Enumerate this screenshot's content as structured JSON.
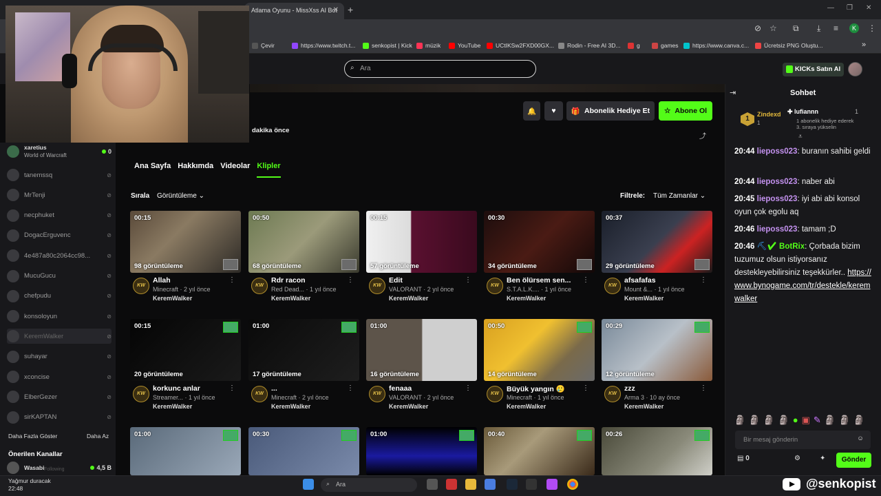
{
  "browser": {
    "tab_title": "Atlama Oyunu - MissXss AI Bot",
    "tab_close": "✕",
    "new_tab": "+",
    "bookmarks": [
      {
        "label": "Çevir",
        "color": "#555"
      },
      {
        "label": "https://www.twitch.t...",
        "color": "#9146ff"
      },
      {
        "label": "senkopist | Kick",
        "color": "#53fc18"
      },
      {
        "label": "müzik",
        "color": "#ff3355"
      },
      {
        "label": "YouTube",
        "color": "#ff0000"
      },
      {
        "label": "UCtIKSw2FXD00GX...",
        "color": "#ff0000"
      },
      {
        "label": "Rodin - Free AI 3D...",
        "color": "#888"
      },
      {
        "label": "g",
        "color": "#d33"
      },
      {
        "label": "games",
        "color": "#c44"
      },
      {
        "label": "https://www.canva.c...",
        "color": "#00c4cc"
      },
      {
        "label": "Ücretsiz PNG Oluştu...",
        "color": "#e44"
      }
    ],
    "more_bookmarks": "»",
    "profile_initial": "K"
  },
  "header": {
    "search_placeholder": "Ara",
    "kicks_button": "KICKs Satın Al"
  },
  "channel": {
    "actions": {
      "gift": "Abonelik Hediye Et",
      "subscribe": "Abone Ol"
    },
    "last_live": "dakika önce",
    "tabs": [
      "Ana Sayfa",
      "Hakkımda",
      "Videolar",
      "Klipler"
    ],
    "sort_label": "Sırala",
    "sort_value": "Görüntüleme",
    "filter_label": "Filtrele:",
    "filter_value": "Tüm Zamanlar"
  },
  "clips": [
    {
      "dur": "00:15",
      "views": "98 görüntüleme",
      "title": "Allah",
      "game": "Minecraft",
      "ago": "2 yıl önce",
      "author": "KeremWalker"
    },
    {
      "dur": "00:50",
      "views": "68 görüntüleme",
      "title": "Rdr racon",
      "game": "Red Dead...",
      "ago": "1 yıl önce",
      "author": "KeremWalker"
    },
    {
      "dur": "00:15",
      "views": "57 görüntüleme",
      "title": "Edit",
      "game": "VALORANT",
      "ago": "2 yıl önce",
      "author": "KeremWalker"
    },
    {
      "dur": "00:30",
      "views": "34 görüntüleme",
      "title": "Ben ölürsem sen...",
      "game": "S.T.A.L.K....",
      "ago": "1 yıl önce",
      "author": "KeremWalker"
    },
    {
      "dur": "00:37",
      "views": "29 görüntüleme",
      "title": "afsafafas",
      "game": "Mount &...",
      "ago": "1 yıl önce",
      "author": "KeremWalker"
    },
    {
      "dur": "00:15",
      "views": "20 görüntüleme",
      "title": "korkunc anlar",
      "game": "Streamer...",
      "ago": "1 yıl önce",
      "author": "KeremWalker"
    },
    {
      "dur": "01:00",
      "views": "17 görüntüleme",
      "title": "...",
      "game": "Minecraft",
      "ago": "2 yıl önce",
      "author": "KeremWalker"
    },
    {
      "dur": "01:00",
      "views": "16 görüntüleme",
      "title": "fenaaa",
      "game": "VALORANT",
      "ago": "2 yıl önce",
      "author": "KeremWalker"
    },
    {
      "dur": "00:50",
      "views": "14 görüntüleme",
      "title": "Büyük yangın 🥲",
      "game": "Minecraft",
      "ago": "1 yıl önce",
      "author": "KeremWalker"
    },
    {
      "dur": "00:29",
      "views": "12 görüntüleme",
      "title": "zzz",
      "game": "Arma 3",
      "ago": "10 ay önce",
      "author": "KeremWalker"
    },
    {
      "dur": "01:00"
    },
    {
      "dur": "00:30"
    },
    {
      "dur": "01:00"
    },
    {
      "dur": "00:40"
    },
    {
      "dur": "00:26"
    }
  ],
  "sidebar": {
    "top_item": {
      "name": "xaretius",
      "sub": "World of Warcraft",
      "count": "0"
    },
    "items": [
      "tanemssq",
      "MrTenji",
      "necphuket",
      "DogacErguvenc",
      "4e487a80c2064cc98...",
      "MucuGucu",
      "chefpudu",
      "konsoloyun",
      "KeremWalker",
      "suhayar",
      "xconcise",
      "ElberGezer",
      "sirKAPTAN"
    ],
    "show_more": "Daha Fazla Göster",
    "show_less": "Daha Az",
    "recommended_title": "Önerilen Kanallar",
    "recommended": {
      "name": "Wasabi",
      "count": "4,5 B"
    },
    "following": "Following"
  },
  "chat": {
    "title": "Sohbet",
    "pinned": {
      "gifter": "Zindexd",
      "gifter_count": "1",
      "recipient": "lufiannn",
      "recipient_count": "1",
      "line1": "1 abonelik hediye ederek",
      "line2": "3. sıraya yükselin"
    },
    "messages": [
      {
        "ts": "20:44",
        "user": "lieposs023",
        "text": "buranın sahibi geldi"
      },
      {
        "ts": "20:44",
        "user": "lieposs023",
        "text": "naber abi"
      },
      {
        "ts": "20:45",
        "user": "lieposs023",
        "text": "iyi abi abi konsol oyun çok egolu aq"
      },
      {
        "ts": "20:46",
        "user": "lieposs023",
        "text": "tamam ;D"
      },
      {
        "ts": "20:46",
        "user": "BotRix",
        "text": "Çorbada bizim tuzumuz olsun istiyorsanız destekleyebilirsiniz teşekkürler..",
        "link": "https://www.bynogame.com/tr/destekle/keremwalker"
      }
    ],
    "input_placeholder": "Bir mesaj gönderin",
    "kicks_count": "0",
    "send": "Gönder"
  },
  "taskbar": {
    "weather_line1": "Yağmur duracak",
    "weather_line2": "22:48",
    "search": "Ara"
  },
  "watermark": "@senkopist"
}
